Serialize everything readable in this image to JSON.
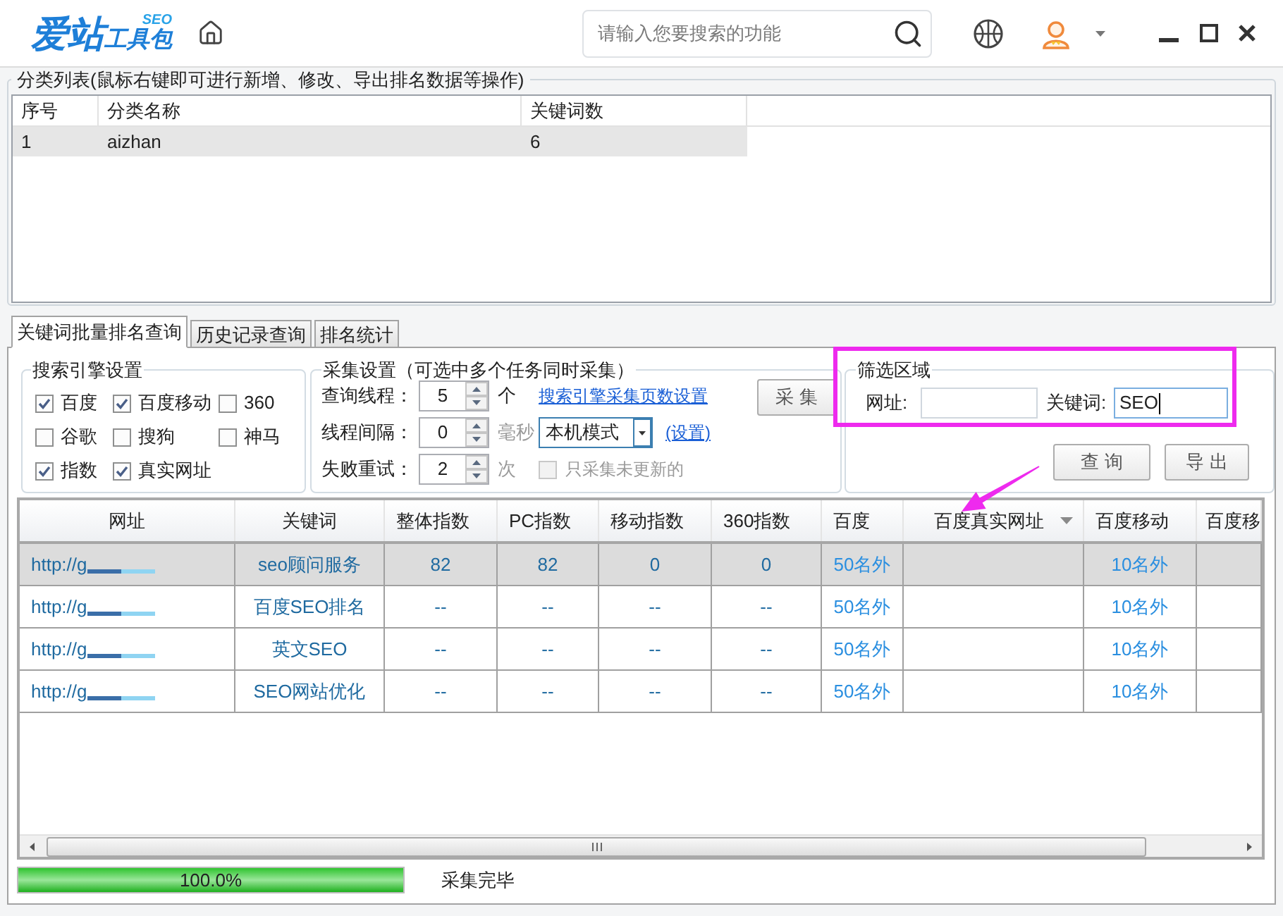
{
  "app": {
    "logo": {
      "text": "爱站",
      "badge": "SEO",
      "subtext": "工具包"
    },
    "search": {
      "placeholder": "请输入您要搜索的功能"
    }
  },
  "category_list": {
    "title": "分类列表(鼠标右键即可进行新增、修改、导出排名数据等操作)",
    "columns": [
      "序号",
      "分类名称",
      "关键词数"
    ],
    "rows": [
      {
        "selected": true,
        "cells": [
          "1",
          "aizhan",
          "6"
        ]
      }
    ]
  },
  "tabs": [
    {
      "label": "关键词批量排名查询",
      "selected": true
    },
    {
      "label": "历史记录查询",
      "selected": false
    },
    {
      "label": "排名统计",
      "selected": false
    }
  ],
  "engine_settings": {
    "title": "搜索引擎设置",
    "options": [
      {
        "label": "百度",
        "checked": true
      },
      {
        "label": "百度移动",
        "checked": true
      },
      {
        "label": "360",
        "checked": false
      },
      {
        "label": "谷歌",
        "checked": false
      },
      {
        "label": "搜狗",
        "checked": false
      },
      {
        "label": "神马",
        "checked": false
      },
      {
        "label": "指数",
        "checked": true
      },
      {
        "label": "真实网址",
        "checked": true
      }
    ]
  },
  "collect_settings": {
    "title": "采集设置（可选中多个任务同时采集）",
    "rows": [
      {
        "kind": "link",
        "label": "查询线程：",
        "value": "5",
        "unit": "个",
        "unit_muted": false,
        "link": "搜索引擎采集页数设置"
      },
      {
        "kind": "mode",
        "label": "线程间隔：",
        "value": "0",
        "unit": "毫秒",
        "unit_muted": true,
        "mode": "本机模式",
        "link": "(设置)"
      },
      {
        "kind": "checkbox",
        "label": "失败重试：",
        "value": "2",
        "unit": "次",
        "unit_muted": true,
        "option": {
          "label": "只采集未更新的",
          "checked": false,
          "disabled": true
        }
      }
    ],
    "button": "采 集"
  },
  "filter": {
    "title": "筛选区域",
    "fields": [
      {
        "label": "网址:",
        "focused": false
      },
      {
        "label": "关键词:",
        "value": "SEO",
        "focused": true
      }
    ],
    "buttons": [
      "查 询",
      "导 出"
    ]
  },
  "results_table": {
    "columns": [
      {
        "label": "网址",
        "kind": "url",
        "dropdown": false
      },
      {
        "label": "关键词",
        "kind": "text",
        "dropdown": false
      },
      {
        "label": "整体指数",
        "kind": "text",
        "dropdown": false
      },
      {
        "label": "PC指数",
        "kind": "text",
        "dropdown": false
      },
      {
        "label": "移动指数",
        "kind": "text",
        "dropdown": false
      },
      {
        "label": "360指数",
        "kind": "text",
        "dropdown": false
      },
      {
        "label": "百度",
        "kind": "rank",
        "dropdown": false
      },
      {
        "label": "百度真实网址",
        "kind": "rank",
        "dropdown": true
      },
      {
        "label": "百度移动",
        "kind": "rank",
        "dropdown": false
      },
      {
        "label": "百度移",
        "kind": "rank",
        "dropdown": false
      }
    ],
    "rows": [
      {
        "selected": true,
        "url": "http://g",
        "keyword": "seo顾问服务",
        "overall_index": "82",
        "pc_index": "82",
        "mobile_index": "0",
        "index_360": "0",
        "baidu": "50名外",
        "baidu_mobile": "10名外"
      },
      {
        "selected": false,
        "url": "http://g",
        "keyword": "百度SEO排名",
        "overall_index": "--",
        "pc_index": "--",
        "mobile_index": "--",
        "index_360": "--",
        "baidu": "50名外",
        "baidu_mobile": "10名外"
      },
      {
        "selected": false,
        "url": "http://g",
        "keyword": "英文SEO",
        "overall_index": "--",
        "pc_index": "--",
        "mobile_index": "--",
        "index_360": "--",
        "baidu": "50名外",
        "baidu_mobile": "10名外"
      },
      {
        "selected": false,
        "url": "http://g",
        "keyword": "SEO网站优化",
        "overall_index": "--",
        "pc_index": "--",
        "mobile_index": "--",
        "index_360": "--",
        "baidu": "50名外",
        "baidu_mobile": "10名外"
      }
    ]
  },
  "progress": {
    "level": 1,
    "label": "100.0%"
  },
  "status": "采集完毕"
}
